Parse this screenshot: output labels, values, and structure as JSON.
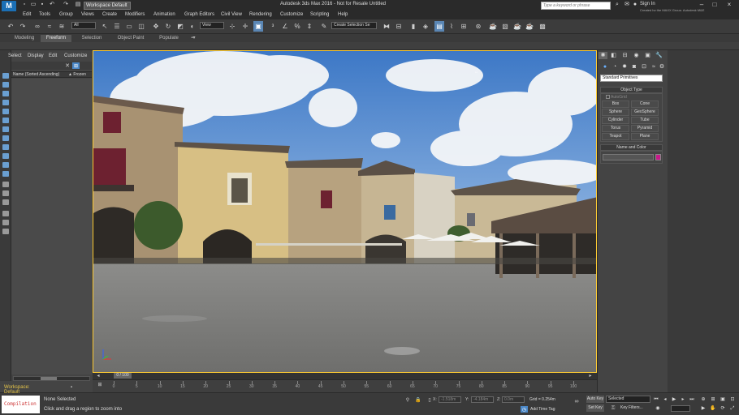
{
  "window": {
    "title": "Autodesk 3ds Max 2016 - Not for Resale    Untitled",
    "app_logo_letter": "M",
    "app_logo_text": "MAX",
    "workspace": "Workspace Default",
    "search_placeholder": "Type a keyword or phrase",
    "signin": "Sign In",
    "credits": "Created by the MAXX Group, Autodesk M&E"
  },
  "menu": [
    "Edit",
    "Tools",
    "Group",
    "Views",
    "Create",
    "Modifiers",
    "Animation",
    "Graph Editors",
    "Civil View",
    "Rendering",
    "Customize",
    "Scripting",
    "Help"
  ],
  "toolbar": {
    "filter_value": "All",
    "view_value": "View",
    "selection_set_value": "Create Selection Se"
  },
  "ribbon_tabs": [
    "Modeling",
    "Freeform",
    "Selection",
    "Object Paint",
    "Populate"
  ],
  "ribbon_active": "Freeform",
  "explorer": {
    "menus": [
      "Select",
      "Display",
      "Edit",
      "Customize"
    ],
    "col_name": "Name (Sorted Ascending)",
    "col_frozen": "▲ Frozen"
  },
  "timeline": {
    "current": "0 / 100",
    "ticks": [
      "0",
      "5",
      "10",
      "15",
      "20",
      "25",
      "30",
      "35",
      "40",
      "45",
      "50",
      "55",
      "60",
      "65",
      "70",
      "75",
      "80",
      "85",
      "90",
      "95",
      "100"
    ]
  },
  "command_panel": {
    "dropdown": "Standard Primitives",
    "object_type": "Object Type",
    "autogrid": "AutoGrid",
    "primitives": [
      "Box",
      "Cone",
      "Sphere",
      "GeoSphere",
      "Cylinder",
      "Tube",
      "Torus",
      "Pyramid",
      "Teapot",
      "Plane"
    ],
    "name_and_color": "Name and Color",
    "color": "#c8198a"
  },
  "status": {
    "workspace_label": "Workspace: Default",
    "compilation": "Compilation",
    "msg1": "None Selected",
    "msg2": "Click and drag a region to zoom into",
    "x_label": "X:",
    "x_value": "-1.518m",
    "y_label": "Y:",
    "y_value": "-4.184m",
    "z_label": "Z:",
    "z_value": "0.0m",
    "grid": "Grid = 0.254m",
    "add_time_tag": "Add Time Tag",
    "auto_key": "Auto Key",
    "set_key": "Set Key",
    "selected": "Selected",
    "key_filters": "Key Filters..."
  }
}
